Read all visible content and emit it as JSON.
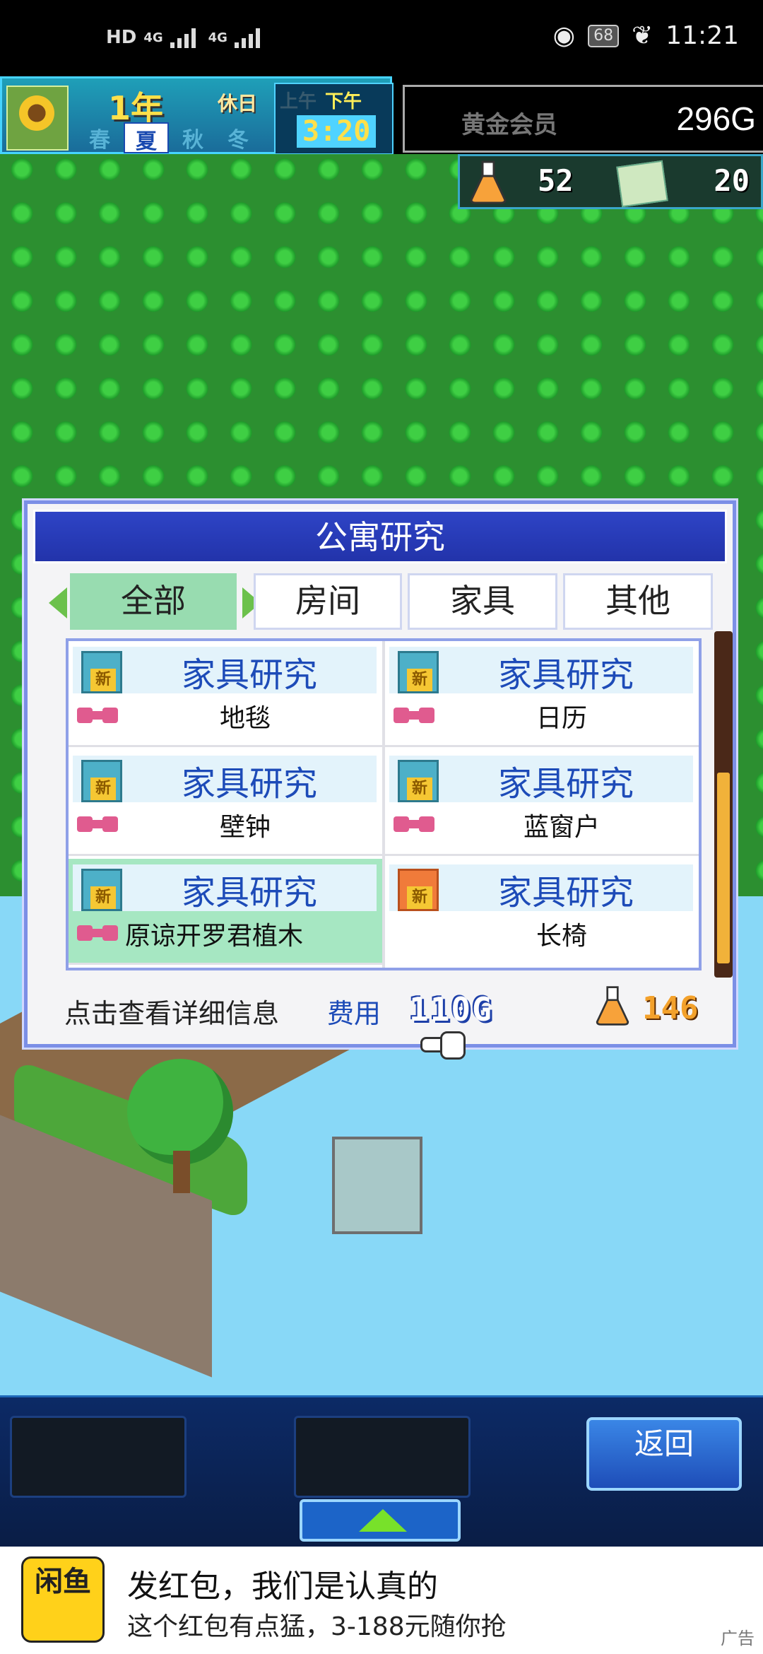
{
  "status_bar": {
    "left_label": "HD",
    "net1": "4G",
    "net2": "4G",
    "battery": "68",
    "time": "11:21"
  },
  "hud": {
    "year": "1年",
    "holiday": "休日",
    "seasons": [
      "春",
      "夏",
      "秋",
      "冬"
    ],
    "active_season": "夏",
    "am": "上午",
    "pm": "下午",
    "time": "3:20",
    "member": "黄金会员",
    "gold": "296G",
    "research_points": "52",
    "book_count": "20"
  },
  "dialog": {
    "title": "公寓研究",
    "tabs": [
      "全部",
      "房间",
      "家具",
      "其他"
    ],
    "active_tab": "全部",
    "items": [
      {
        "title": "家具研究",
        "name": "地毯",
        "icon": "new-research-icon"
      },
      {
        "title": "家具研究",
        "name": "日历",
        "icon": "new-research-icon"
      },
      {
        "title": "家具研究",
        "name": "壁钟",
        "icon": "new-research-icon"
      },
      {
        "title": "家具研究",
        "name": "蓝窗户",
        "icon": "new-research-icon"
      },
      {
        "title": "家具研究",
        "name": "原谅开罗君植木",
        "icon": "new-research-icon"
      },
      {
        "title": "家具研究",
        "name": "长椅",
        "icon": "new-research-orange-icon"
      }
    ],
    "hint": "点击查看详细信息",
    "cost_label": "费用",
    "cost_value": "110G",
    "research_cost": "146"
  },
  "controls": {
    "back_label": "返回"
  },
  "ad": {
    "logo_text": "闲鱼",
    "title": "发红包，我们是认真的",
    "subtitle": "这个红包有点猛，3-188元随你抢",
    "tag": "广告"
  },
  "colors": {
    "accent": "#2e44c6",
    "highlight": "#a6e7c2",
    "title_blue": "#1d4bb8"
  }
}
